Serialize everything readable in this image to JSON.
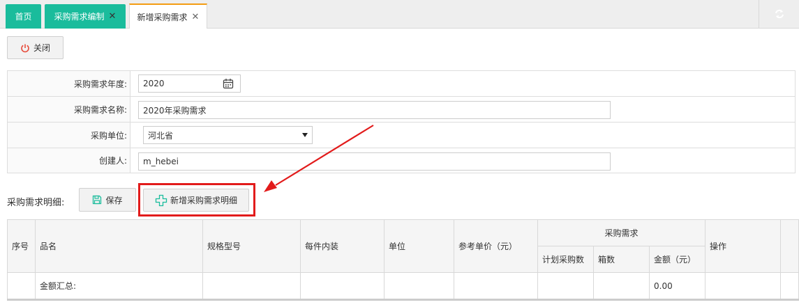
{
  "tabs": [
    {
      "label": "首页"
    },
    {
      "label": "采购需求编制",
      "close": "✕"
    },
    {
      "label": "新增采购需求",
      "close": "✕"
    }
  ],
  "toolbar": {
    "close_label": "关闭"
  },
  "form": {
    "year_label": "采购需求年度:",
    "year_value": "2020",
    "name_label": "采购需求名称:",
    "name_value": "2020年采购需求",
    "unit_label": "采购单位:",
    "unit_value": "河北省",
    "creator_label": "创建人:",
    "creator_value": "m_hebei"
  },
  "detail": {
    "section_label": "采购需求明细:",
    "save_label": "保存",
    "add_label": "新增采购需求明细"
  },
  "table": {
    "headers": {
      "seq": "序号",
      "name": "品名",
      "spec": "规格型号",
      "pack": "每件内装",
      "unit": "单位",
      "price": "参考单价（元）",
      "demand_group": "采购需求",
      "plan_qty": "计划采购数",
      "boxes": "箱数",
      "amount": "金额（元）",
      "ops": "操作"
    },
    "summary": {
      "label": "金额汇总:",
      "amount": "0.00"
    }
  },
  "icons": {
    "close_button_icon": "power-icon",
    "save_icon": "floppy-icon",
    "add_icon": "plus-icon",
    "calendar": "calendar-icon",
    "refresh": "refresh-icon"
  },
  "colors": {
    "tab_green": "#1abc9c",
    "tab_active_top": "#f39c12",
    "highlight": "#e21b1b"
  }
}
